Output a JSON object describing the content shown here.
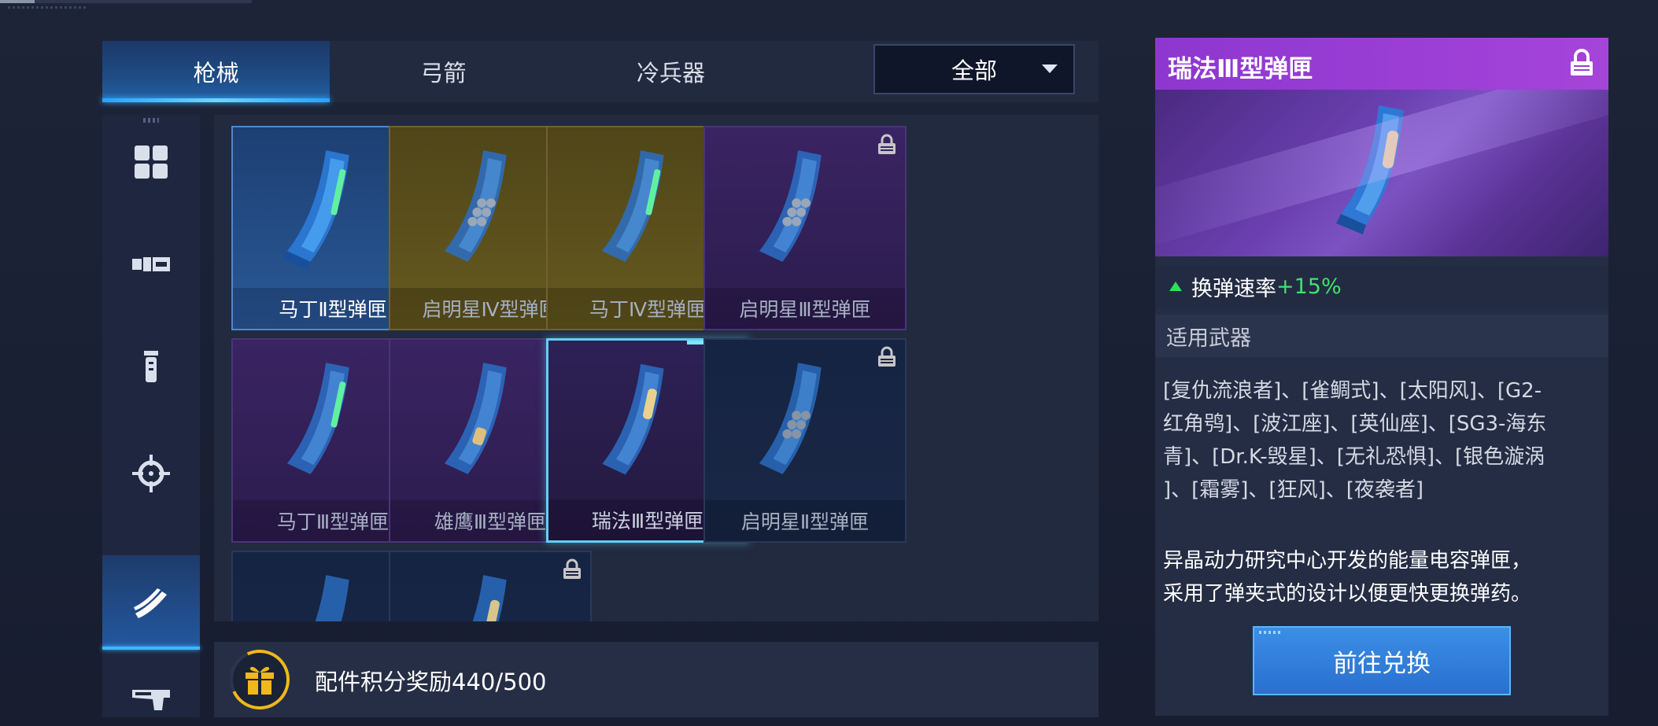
{
  "tabs": [
    {
      "label": "枪械"
    },
    {
      "label": "弓箭"
    },
    {
      "label": "冷兵器"
    }
  ],
  "filter": {
    "selected": "全部"
  },
  "side_icons": [
    "grid-icon",
    "barrel-icon",
    "grip-icon",
    "scope-icon",
    "magazine-icon",
    "stock-icon"
  ],
  "items": [
    {
      "name": "马丁Ⅱ型弹匣",
      "rarity": "blue",
      "locked": false
    },
    {
      "name": "启明星Ⅳ型弹匣",
      "rarity": "gold",
      "locked": true
    },
    {
      "name": "马丁Ⅳ型弹匣",
      "rarity": "gold",
      "locked": true
    },
    {
      "name": "启明星Ⅲ型弹匣",
      "rarity": "purple",
      "locked": true
    },
    {
      "name": "马丁Ⅲ型弹匣",
      "rarity": "purple",
      "locked": true
    },
    {
      "name": "雄鹰Ⅲ型弹匣",
      "rarity": "purple",
      "locked": true
    },
    {
      "name": "瑞法Ⅲ型弹匣",
      "rarity": "purple",
      "locked": true
    },
    {
      "name": "启明星Ⅱ型弹匣",
      "rarity": "navy",
      "locked": true
    },
    {
      "name": "",
      "rarity": "navy",
      "locked": true
    },
    {
      "name": "",
      "rarity": "navy",
      "locked": true
    }
  ],
  "reward": {
    "label": "配件积分奖励",
    "current": "440",
    "total": "500",
    "text": "配件积分奖励440/500"
  },
  "detail": {
    "title": "瑞法Ⅲ型弹匣",
    "stat_label": "换弹速率",
    "stat_value": "+15%",
    "weapons_heading": "适用武器",
    "weapons_lines": [
      "[复仇流浪者]、[雀鲷式]、[太阳风]、[G2-",
      "红角鸮]、[波江座]、[英仙座]、[SG3-海东",
      "青]、[Dr.K-毁星]、[无礼恐惧]、[银色漩涡",
      "]、[霜雾]、[狂风]、[夜袭者]"
    ],
    "description_lines": [
      "异晶动力研究中心开发的能量电容弹匣，",
      "采用了弹夹式的设计以便更快更换弹药。"
    ],
    "button_label": "前往兑换"
  },
  "colors": {
    "accent_blue": "#2aa2ff",
    "rarity_purple": "#8d37d0",
    "stat_green": "#3fe26a",
    "reward_gold": "#f1b81c"
  }
}
